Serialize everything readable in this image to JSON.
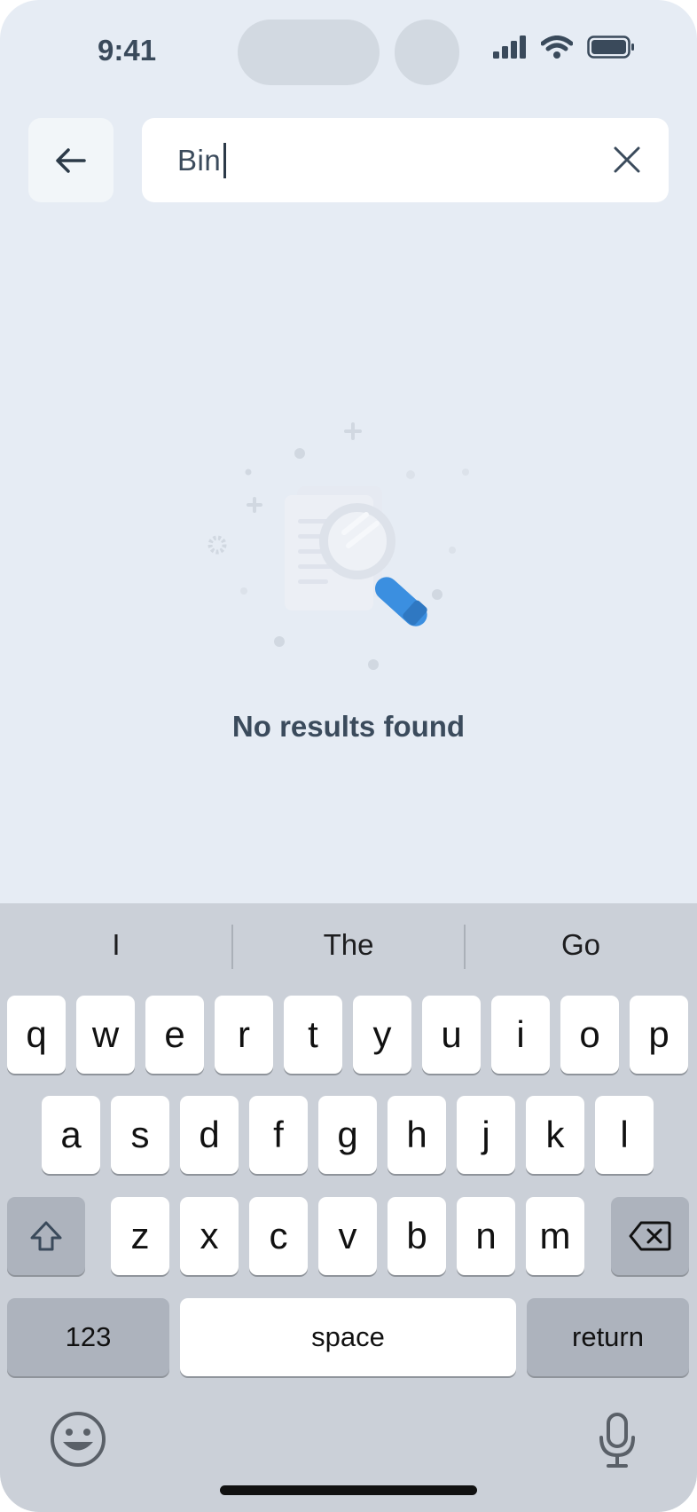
{
  "status": {
    "time": "9:41"
  },
  "search": {
    "query": "Bin"
  },
  "empty_state": {
    "message": "No results found"
  },
  "keyboard": {
    "suggestions": [
      "I",
      "The",
      "Go"
    ],
    "row1": [
      "q",
      "w",
      "e",
      "r",
      "t",
      "y",
      "u",
      "i",
      "o",
      "p"
    ],
    "row2": [
      "a",
      "s",
      "d",
      "f",
      "g",
      "h",
      "j",
      "k",
      "l"
    ],
    "row3": [
      "z",
      "x",
      "c",
      "v",
      "b",
      "n",
      "m"
    ],
    "numbers_label": "123",
    "space_label": "space",
    "return_label": "return"
  },
  "colors": {
    "accent": "#3b8fe0",
    "background": "#e6ecf4",
    "text": "#3b4b5c"
  }
}
